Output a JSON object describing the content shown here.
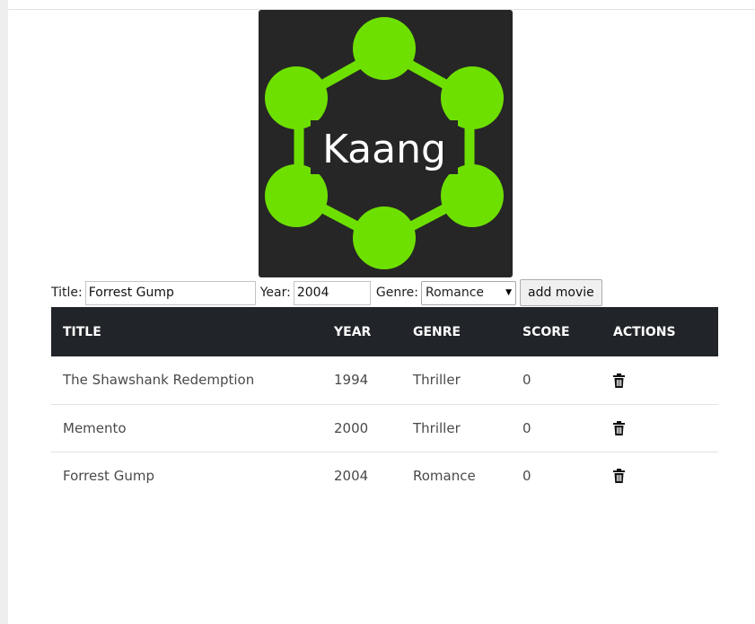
{
  "logo": {
    "text": "Kaang",
    "background_color": "#262626",
    "accent_color": "#6ee000",
    "text_color": "#ffffff"
  },
  "form": {
    "title_label": "Title:",
    "title_value": "Forrest Gump",
    "year_label": "Year:",
    "year_value": "2004",
    "genre_label": "Genre:",
    "genre_selected": "Romance",
    "add_button_label": "add movie"
  },
  "table": {
    "header_color": "#212529",
    "columns": [
      "TITLE",
      "YEAR",
      "GENRE",
      "SCORE",
      "ACTIONS"
    ],
    "rows": [
      {
        "title": "The Shawshank Redemption",
        "year": "1994",
        "genre": "Thriller",
        "score": "0",
        "action_icon": "trash-icon"
      },
      {
        "title": "Memento",
        "year": "2000",
        "genre": "Thriller",
        "score": "0",
        "action_icon": "trash-icon"
      },
      {
        "title": "Forrest Gump",
        "year": "2004",
        "genre": "Romance",
        "score": "0",
        "action_icon": "trash-icon"
      }
    ]
  }
}
